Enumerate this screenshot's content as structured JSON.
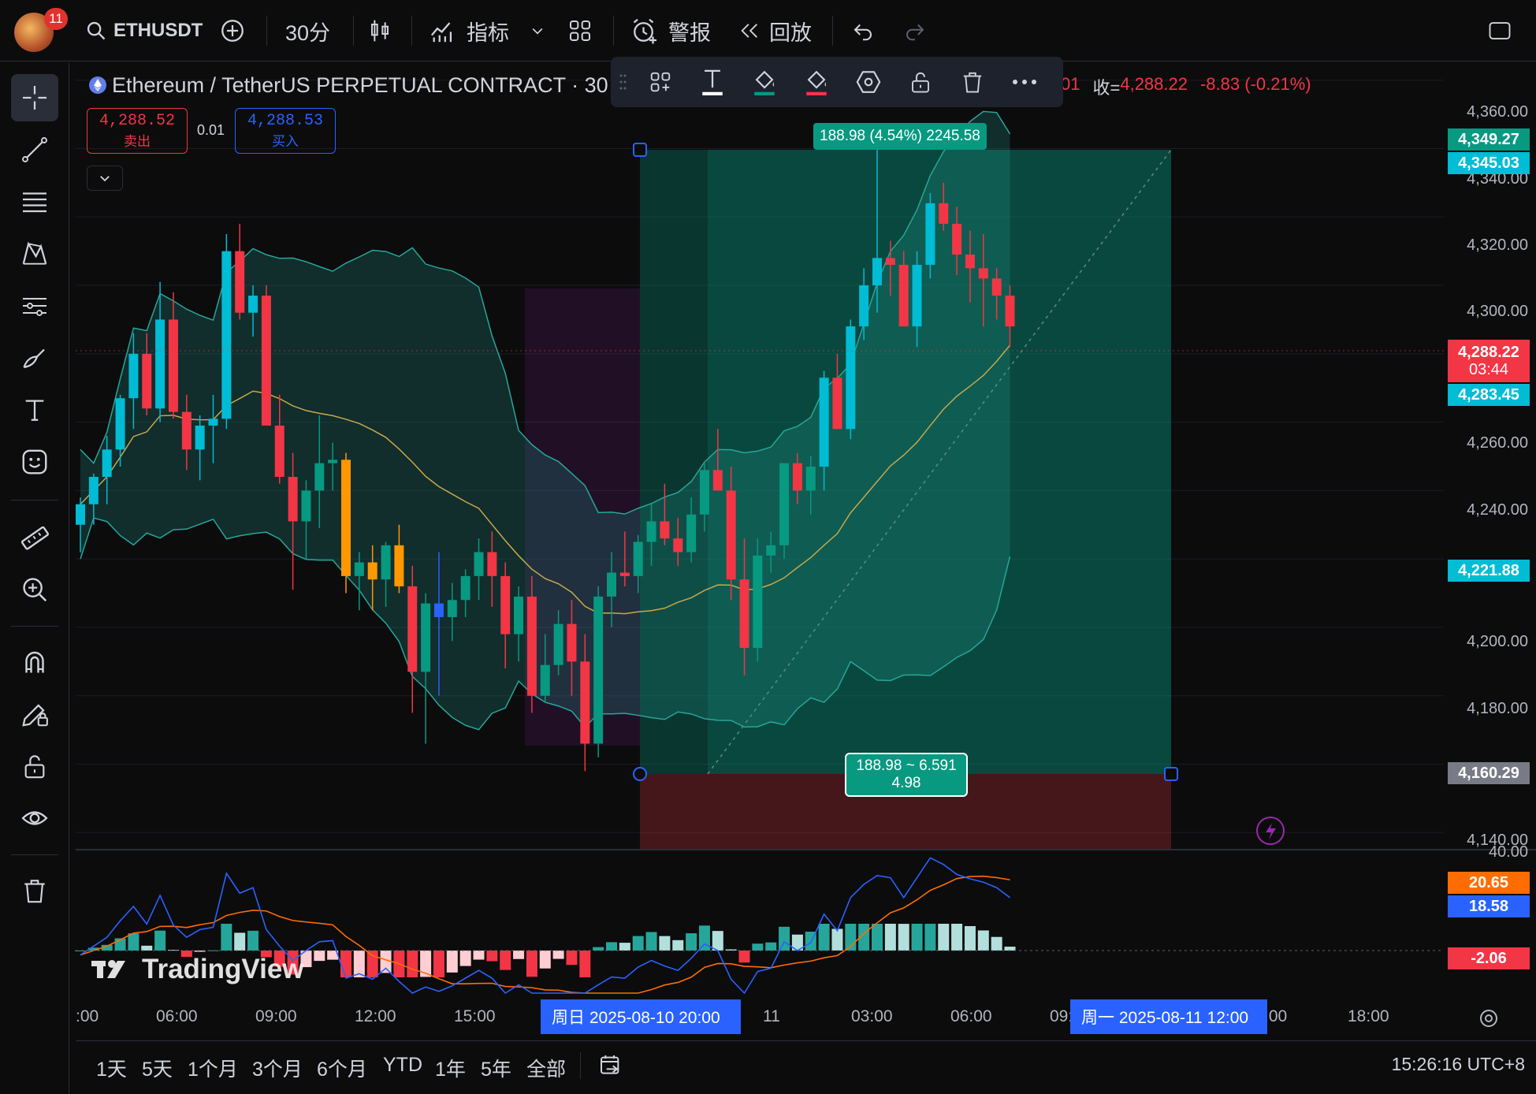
{
  "topbar": {
    "notification_count": "11",
    "symbol": "ETHUSDT",
    "interval": "30分",
    "indicators": "指标",
    "alert": "警报",
    "replay": "回放"
  },
  "legend": {
    "title": "Ethereum / TetherUS PERPETUAL CONTRACT · 30 ·",
    "ohlc_tail": "01",
    "close_label": "收=",
    "close_value": "4,288.22",
    "change": "-8.83 (-0.21%)"
  },
  "trade": {
    "sell_price": "4,288.52",
    "sell_label": "卖出",
    "spread": "0.01",
    "buy_price": "4,288.53",
    "buy_label": "买入"
  },
  "position_tool": {
    "top_label": "188.98 (4.54%) 2245.58",
    "center_line1": "188.98 ~ 6.591",
    "center_line2": "4.98"
  },
  "price_axis": {
    "ticks": [
      "4,360.00",
      "4,340.00",
      "4,320.00",
      "4,300.00",
      "4,260.00",
      "4,240.00",
      "4,200.00",
      "4,180.00",
      "4,140.00"
    ],
    "tags": {
      "target": "4,349.27",
      "upper_band": "4,345.03",
      "last_price": "4,288.22",
      "countdown": "03:44",
      "mid_band": "4,283.45",
      "lower_band": "4,221.88",
      "stop": "4,160.29"
    }
  },
  "macd_axis": {
    "top": "40.00",
    "signal": "20.65",
    "macd": "18.58",
    "hist": "-2.06"
  },
  "watermark": "TradingView",
  "time_axis": {
    "labels": [
      ":00",
      "06:00",
      "09:00",
      "12:00",
      "15:00",
      "11",
      "03:00",
      "06:00",
      "09:",
      ":00",
      "18:00"
    ],
    "tag_left": "周日 2025-08-10   20:00",
    "tag_right": "周一 2025-08-11   12:00"
  },
  "ranges": [
    "1天",
    "5天",
    "1个月",
    "3个月",
    "6个月",
    "YTD",
    "1年",
    "5年",
    "全部"
  ],
  "clock": "15:26:16 UTC+8",
  "colors": {
    "up": "#089981",
    "down": "#f23645",
    "cyan": "#00bcd4",
    "blue": "#2962ff",
    "orange": "#ff9800"
  },
  "chart_data": {
    "type": "candlestick",
    "symbol": "ETHUSDT",
    "interval": "30",
    "ylim": [
      4135,
      4365
    ],
    "candles": [
      [
        4230,
        4238,
        4222,
        4236
      ],
      [
        4236,
        4245,
        4230,
        4244
      ],
      [
        4244,
        4256,
        4236,
        4252
      ],
      [
        4252,
        4268,
        4247,
        4267
      ],
      [
        4267,
        4286,
        4258,
        4280
      ],
      [
        4280,
        4286,
        4262,
        4264
      ],
      [
        4264,
        4301,
        4260,
        4290
      ],
      [
        4290,
        4298,
        4261,
        4263
      ],
      [
        4263,
        4268,
        4246,
        4252
      ],
      [
        4252,
        4262,
        4243,
        4259
      ],
      [
        4259,
        4268,
        4248,
        4261
      ],
      [
        4261,
        4315,
        4258,
        4310
      ],
      [
        4310,
        4318,
        4290,
        4292
      ],
      [
        4292,
        4300,
        4285,
        4297
      ],
      [
        4297,
        4300,
        4263,
        4259
      ],
      [
        4259,
        4268,
        4242,
        4244
      ],
      [
        4244,
        4251,
        4211,
        4231
      ],
      [
        4231,
        4243,
        4220,
        4240
      ],
      [
        4240,
        4262,
        4229,
        4248
      ],
      [
        4248,
        4254,
        4240,
        4249
      ],
      [
        4249,
        4251,
        4210,
        4215
      ],
      [
        4215,
        4222,
        4205,
        4219
      ],
      [
        4219,
        4224,
        4205,
        4214
      ],
      [
        4214,
        4225,
        4206,
        4224
      ],
      [
        4224,
        4230,
        4210,
        4212
      ],
      [
        4212,
        4218,
        4175,
        4187
      ],
      [
        4187,
        4210,
        4166,
        4207
      ],
      [
        4207,
        4222,
        4180,
        4203
      ],
      [
        4203,
        4213,
        4196,
        4208
      ],
      [
        4208,
        4217,
        4203,
        4215
      ],
      [
        4215,
        4226,
        4208,
        4222
      ],
      [
        4222,
        4228,
        4206,
        4215
      ],
      [
        4215,
        4219,
        4188,
        4198
      ],
      [
        4198,
        4212,
        4190,
        4209
      ],
      [
        4209,
        4215,
        4175,
        4180
      ],
      [
        4180,
        4198,
        4178,
        4189
      ],
      [
        4189,
        4205,
        4186,
        4201
      ],
      [
        4201,
        4208,
        4180,
        4190
      ],
      [
        4190,
        4198,
        4158,
        4166
      ],
      [
        4166,
        4212,
        4162,
        4209
      ],
      [
        4209,
        4222,
        4200,
        4216
      ],
      [
        4216,
        4228,
        4212,
        4215
      ],
      [
        4215,
        4227,
        4210,
        4225
      ],
      [
        4225,
        4236,
        4218,
        4231
      ],
      [
        4231,
        4242,
        4224,
        4226
      ],
      [
        4226,
        4232,
        4218,
        4222
      ],
      [
        4222,
        4238,
        4219,
        4233
      ],
      [
        4233,
        4248,
        4228,
        4246
      ],
      [
        4246,
        4258,
        4240,
        4240
      ],
      [
        4240,
        4247,
        4208,
        4214
      ],
      [
        4214,
        4226,
        4186,
        4194
      ],
      [
        4194,
        4226,
        4190,
        4221
      ],
      [
        4221,
        4228,
        4216,
        4224
      ],
      [
        4224,
        4246,
        4220,
        4248
      ],
      [
        4248,
        4251,
        4236,
        4240
      ],
      [
        4240,
        4250,
        4233,
        4247
      ],
      [
        4247,
        4275,
        4240,
        4273
      ],
      [
        4273,
        4280,
        4258,
        4258
      ],
      [
        4258,
        4290,
        4255,
        4288
      ],
      [
        4288,
        4305,
        4284,
        4300
      ],
      [
        4300,
        4345,
        4292,
        4308
      ],
      [
        4308,
        4313,
        4297,
        4306
      ],
      [
        4306,
        4310,
        4288,
        4288
      ],
      [
        4288,
        4310,
        4282,
        4306
      ],
      [
        4306,
        4327,
        4302,
        4324
      ],
      [
        4324,
        4330,
        4316,
        4318
      ],
      [
        4318,
        4323,
        4303,
        4309
      ],
      [
        4309,
        4316,
        4295,
        4305
      ],
      [
        4305,
        4315,
        4288,
        4302
      ],
      [
        4302,
        4305,
        4290,
        4297
      ],
      [
        4297,
        4300,
        4282,
        4288
      ]
    ],
    "position_tool": {
      "entry": 4160.29,
      "target": 4349.27,
      "stop": 4140.0
    },
    "bollinger": {
      "upper": 4345.03,
      "middle": 4283.45,
      "lower": 4221.88
    },
    "macd": {
      "signal": 20.65,
      "macd": 18.58,
      "histogram": -2.06
    }
  }
}
